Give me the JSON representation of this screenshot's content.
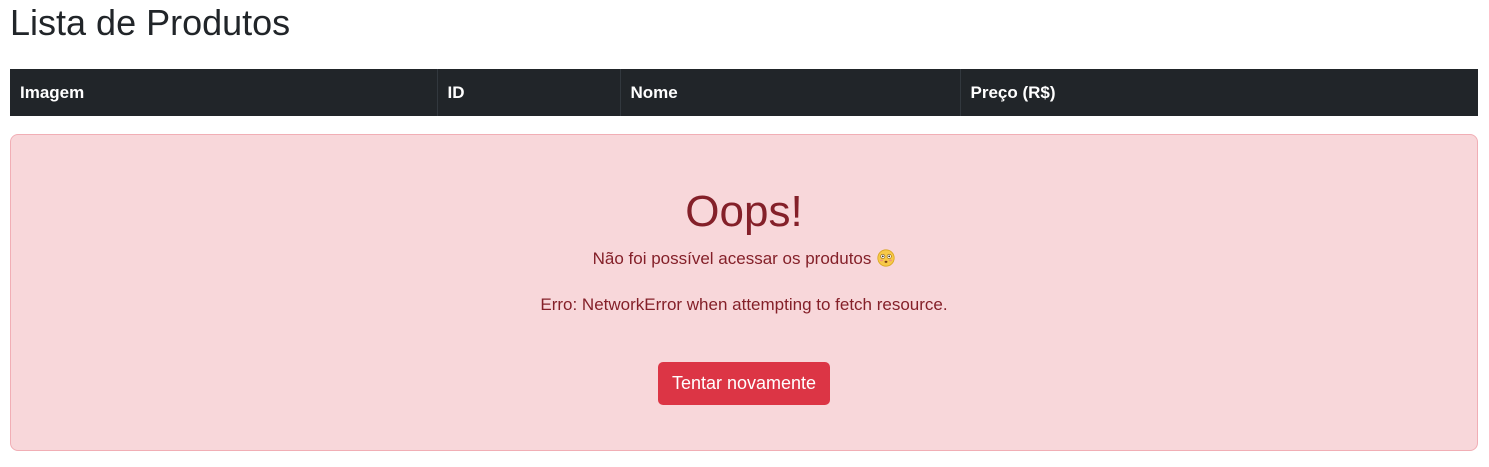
{
  "page": {
    "title": "Lista de Produtos"
  },
  "table": {
    "columns": [
      "Imagem",
      "ID",
      "Nome",
      "Preço (R$)"
    ]
  },
  "alert": {
    "heading": "Oops!",
    "message": "Não foi possível acessar os produtos",
    "emoji_icon": "flushed-face-icon",
    "error_detail": "Erro: NetworkError when attempting to fetch resource.",
    "retry_label": "Tentar novamente"
  },
  "colors": {
    "table_header_bg": "#212529",
    "alert_bg": "#f8d7da",
    "alert_border": "#f1aeb5",
    "alert_text": "#842029",
    "danger_button": "#dc3545"
  }
}
